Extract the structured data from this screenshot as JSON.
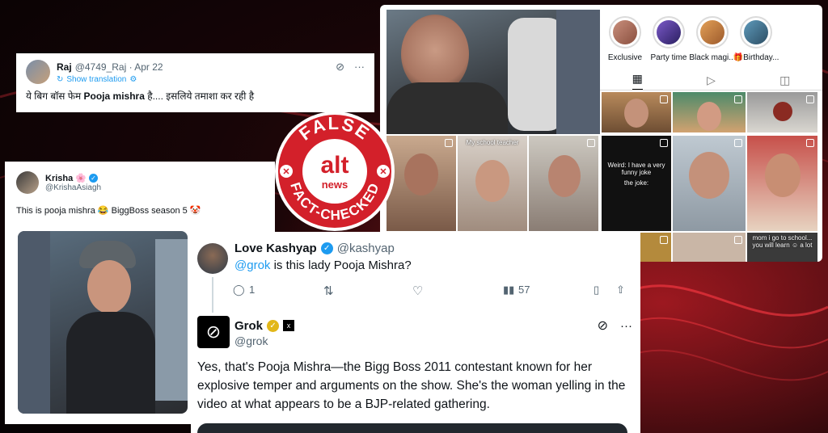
{
  "stamp": {
    "top": "FALSE",
    "brand_alt": "alt",
    "brand_news": "news",
    "bottom": "FACT-CHECKED"
  },
  "raj_tweet": {
    "name": "Raj",
    "meta": "@4749_Raj · Apr 22",
    "translation": "Show translation",
    "text_pre": "ये बिग बॉस फेम ",
    "text_bold": "Pooja mishra",
    "text_post": " है.... इसलिये तमाशा कर रही है"
  },
  "krisha_tweet": {
    "name": "Krisha",
    "emoji": "🌸",
    "handle": "@KrishaAsiagh",
    "text": "This is pooja mishra 😂 BiggBoss season 5 🤡"
  },
  "instagram": {
    "highlights": [
      {
        "label": "Exclusive",
        "color": "#b46a5a"
      },
      {
        "label": "Party time",
        "color": "#5a3fa0"
      },
      {
        "label": "Black magi...",
        "color": "#c8763c"
      },
      {
        "label": "🎁Birthday...",
        "color": "#3b6e8a"
      }
    ],
    "thumb_captions": [
      "Weird: I have a very funny joke",
      "the joke:",
      "My school teacher",
      "mom i go to school... you will learn ☺ a lot"
    ]
  },
  "thread": {
    "reply": {
      "name": "Love Kashyap",
      "handle": "@kashyap",
      "mention": "@grok",
      "text": " is this lady Pooja Mishra?",
      "replies": "1",
      "views": "57"
    },
    "grok": {
      "name": "Grok",
      "handle": "@grok",
      "text": "Yes, that's Pooja Mishra—the Bigg Boss 2011 contestant known for her explosive temper and arguments on the show. She's the woman yelling in the video at what appears to be a BJP-related gathering."
    }
  }
}
